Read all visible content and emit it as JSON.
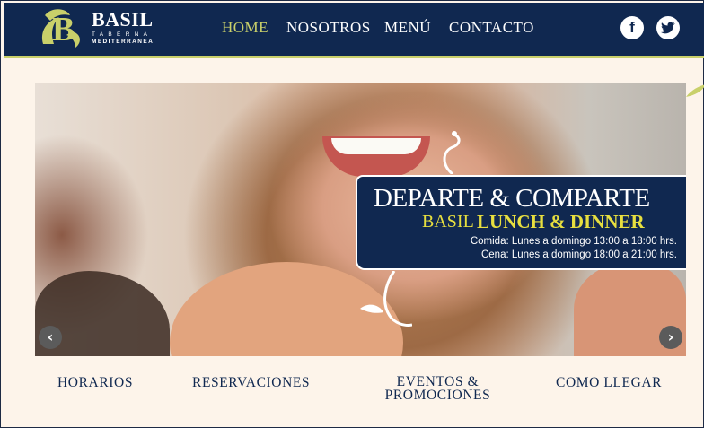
{
  "brand": {
    "name": "BASIL",
    "subtitle_line1": "TABERNA",
    "subtitle_line2": "MEDITERRANEA",
    "logo_letter": "B",
    "colors": {
      "navy": "#102850",
      "accent": "#c9d06a",
      "yellow": "#e7df3f",
      "background": "#fdf4ea"
    }
  },
  "nav": {
    "items": [
      {
        "label": "HOME",
        "active": true
      },
      {
        "label": "NOSOTROS",
        "active": false
      },
      {
        "label": "MENÚ",
        "active": false
      },
      {
        "label": "CONTACTO",
        "active": false
      }
    ]
  },
  "social": {
    "facebook": {
      "glyph": "f",
      "icon": "facebook-icon"
    },
    "twitter": {
      "glyph": "🐦",
      "icon": "twitter-icon"
    }
  },
  "hero": {
    "banner_title": "DEPARTE & COMPARTE",
    "banner_brand": "BASIL",
    "banner_highlight": "LUNCH & DINNER",
    "lunch_hours": "Comida: Lunes a domingo 13:00 a 18:00 hrs.",
    "dinner_hours": "Cena: Lunes a domingo 18:00 a 21:00 hrs.",
    "prev_glyph": "‹",
    "next_glyph": "›"
  },
  "links": {
    "horarios": "HORARIOS",
    "reservaciones": "RESERVACIONES",
    "eventos_line1": "EVENTOS &",
    "eventos_line2": "PROMOCIONES",
    "como_llegar": "COMO LLEGAR"
  }
}
